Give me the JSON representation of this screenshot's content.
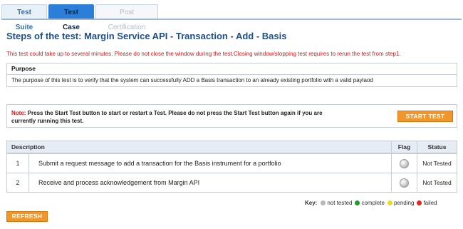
{
  "tabs": [
    {
      "label": "Test Suite"
    },
    {
      "label": "Test Case"
    },
    {
      "label": "Post Certification"
    }
  ],
  "title": "Steps of the test: Margin Service API - Transaction - Add - Basis",
  "warning": "This test could take up to several minutes. Please do not close the window during the test.Closing window/stopping test requires to rerun the test from step1.",
  "purpose": {
    "heading": "Purpose",
    "text": "The purpose of this test is to verify that the system can successfully ADD a Basis transaction to an already existing portfolio with a valid paylaod"
  },
  "note": {
    "label": "Note:",
    "text": " Press the Start Test button to start or restart a Test. Please do not press the Start Test button again if you are currently running this test.",
    "start_button": "START TEST"
  },
  "steps": {
    "headers": {
      "description": "Description",
      "flag": "Flag",
      "status": "Status"
    },
    "rows": [
      {
        "num": "1",
        "description": "Submit a request message to add a transaction for the Basis instrument for a portfolio",
        "flag": "gray-circle-icon",
        "status": "Not Tested"
      },
      {
        "num": "2",
        "description": "Receive and process acknowledgement from Margin API",
        "flag": "gray-circle-icon",
        "status": "Not Tested"
      }
    ]
  },
  "key": {
    "title": "Key:",
    "items": [
      {
        "label": "not tested",
        "color": "#b9b9b9"
      },
      {
        "label": "complete",
        "color": "#1e9e27"
      },
      {
        "label": "pending",
        "color": "#f2d81b"
      },
      {
        "label": "failed",
        "color": "#df2a1e"
      }
    ]
  },
  "refresh_button": "REFRESH"
}
